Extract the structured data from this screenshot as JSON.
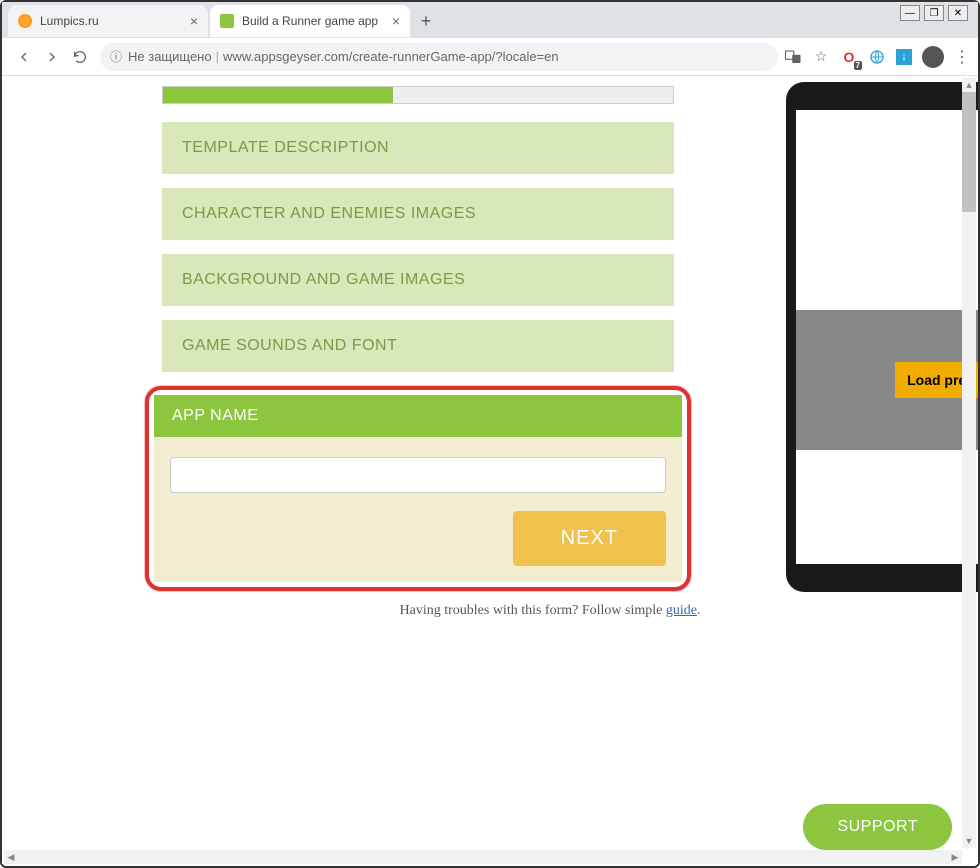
{
  "window": {
    "titlebar_min": "—",
    "titlebar_max": "❐",
    "titlebar_close": "✕"
  },
  "tabs": [
    {
      "title": "Lumpics.ru",
      "active": false
    },
    {
      "title": "Build a Runner game app",
      "active": true
    }
  ],
  "address": {
    "insecure_label": "Не защищено",
    "url_path": "www.appsgeyser.com/create-runnerGame-app/?locale=en"
  },
  "steps": {
    "template_desc": "TEMPLATE DESCRIPTION",
    "character_images": "CHARACTER AND ENEMIES IMAGES",
    "background_images": "BACKGROUND AND GAME IMAGES",
    "sounds_font": "GAME SOUNDS AND FONT"
  },
  "app_name_section": {
    "header": "APP NAME",
    "input_value": "",
    "next_label": "NEXT"
  },
  "help": {
    "prefix": "Having troubles with this form? Follow simple ",
    "link": "guide",
    "suffix": "."
  },
  "preview": {
    "load_label": "Load prev"
  },
  "support_label": "SUPPORT"
}
